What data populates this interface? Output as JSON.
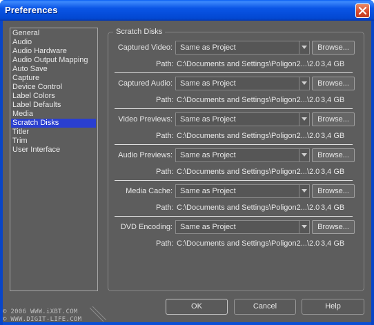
{
  "window": {
    "title": "Preferences"
  },
  "sidebar": {
    "items": [
      {
        "label": "General"
      },
      {
        "label": "Audio"
      },
      {
        "label": "Audio Hardware"
      },
      {
        "label": "Audio Output Mapping"
      },
      {
        "label": "Auto Save"
      },
      {
        "label": "Capture"
      },
      {
        "label": "Device Control"
      },
      {
        "label": "Label Colors"
      },
      {
        "label": "Label Defaults"
      },
      {
        "label": "Media"
      },
      {
        "label": "Scratch Disks"
      },
      {
        "label": "Titler"
      },
      {
        "label": "Trim"
      },
      {
        "label": "User Interface"
      }
    ],
    "selected": "Scratch Disks"
  },
  "scratch_disks": {
    "group_title": "Scratch Disks",
    "path_label": "Path:",
    "browse_label": "Browse...",
    "rows": [
      {
        "label": "Captured Video:",
        "value": "Same as Project",
        "path": "C:\\Documents and Settings\\Poligon2...\\2.0",
        "size": "3,4 GB"
      },
      {
        "label": "Captured Audio:",
        "value": "Same as Project",
        "path": "C:\\Documents and Settings\\Poligon2...\\2.0",
        "size": "3,4 GB"
      },
      {
        "label": "Video Previews:",
        "value": "Same as Project",
        "path": "C:\\Documents and Settings\\Poligon2...\\2.0",
        "size": "3,4 GB"
      },
      {
        "label": "Audio Previews:",
        "value": "Same as Project",
        "path": "C:\\Documents and Settings\\Poligon2...\\2.0",
        "size": "3,4 GB"
      },
      {
        "label": "Media Cache:",
        "value": "Same as Project",
        "path": "C:\\Documents and Settings\\Poligon2...\\2.0",
        "size": "3,4 GB"
      },
      {
        "label": "DVD Encoding:",
        "value": "Same as Project",
        "path": "C:\\Documents and Settings\\Poligon2...\\2.0",
        "size": "3,4 GB"
      }
    ]
  },
  "buttons": {
    "ok": "OK",
    "cancel": "Cancel",
    "help": "Help"
  },
  "watermark": {
    "line1": "© 2006 WWW.iXBT.COM",
    "line2": "© WWW.DIGIT-LIFE.COM"
  }
}
